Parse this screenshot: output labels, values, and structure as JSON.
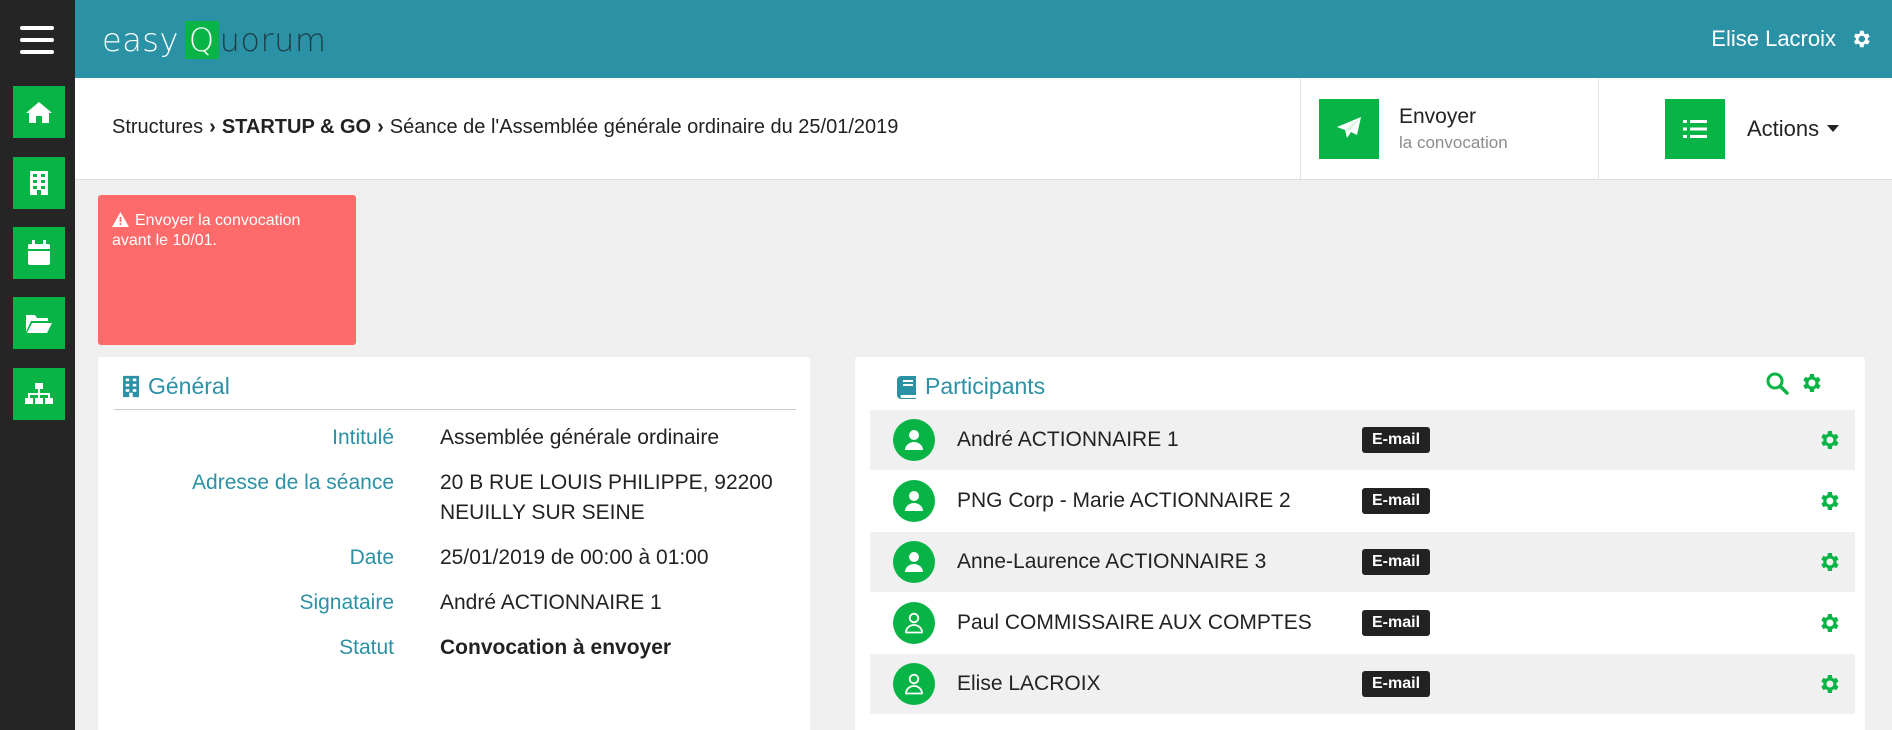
{
  "app": {
    "logo_prefix": "easy",
    "logo_q": "Q",
    "logo_suffix": "uorum",
    "user_name": "Elise Lacroix"
  },
  "sidebar": {
    "items": [
      "home-icon",
      "building-icon",
      "calendar-icon",
      "folder-open-icon",
      "sitemap-icon"
    ]
  },
  "breadcrumb": {
    "root": "Structures",
    "company": "STARTUP & GO",
    "current": "Séance de l'Assemblée générale ordinaire du 25/01/2019"
  },
  "header": {
    "send_title": "Envoyer",
    "send_subtitle": "la convocation",
    "actions_label": "Actions"
  },
  "alert": {
    "text": "Envoyer la convocation avant le 10/01."
  },
  "general": {
    "title": "Général",
    "rows": [
      {
        "label": "Intitulé",
        "value": "Assemblée générale ordinaire"
      },
      {
        "label": "Adresse de la séance",
        "value": "20 B RUE LOUIS PHILIPPE, 92200 NEUILLY SUR SEINE"
      },
      {
        "label": "Date",
        "value": "25/01/2019 de 00:00 à 01:00"
      },
      {
        "label": "Signataire",
        "value": "André ACTIONNAIRE 1"
      },
      {
        "label": "Statut",
        "value": "Convocation à envoyer"
      }
    ]
  },
  "participants": {
    "title": "Participants",
    "rows": [
      {
        "name": "André ACTIONNAIRE 1",
        "badge": "E-mail",
        "avatar": "user-filled-icon"
      },
      {
        "name": "PNG Corp - Marie ACTIONNAIRE 2",
        "badge": "E-mail",
        "avatar": "user-filled-icon"
      },
      {
        "name": "Anne-Laurence ACTIONNAIRE 3",
        "badge": "E-mail",
        "avatar": "user-filled-icon"
      },
      {
        "name": "Paul COMMISSAIRE AUX COMPTES",
        "badge": "E-mail",
        "avatar": "user-outline-icon"
      },
      {
        "name": "Elise LACROIX",
        "badge": "E-mail",
        "avatar": "user-outline-icon"
      }
    ]
  },
  "colors": {
    "brand_teal": "#2b91a5",
    "accent_green": "#09b446",
    "alert_red": "#ff6b6b",
    "sidebar_dark": "#252525"
  }
}
